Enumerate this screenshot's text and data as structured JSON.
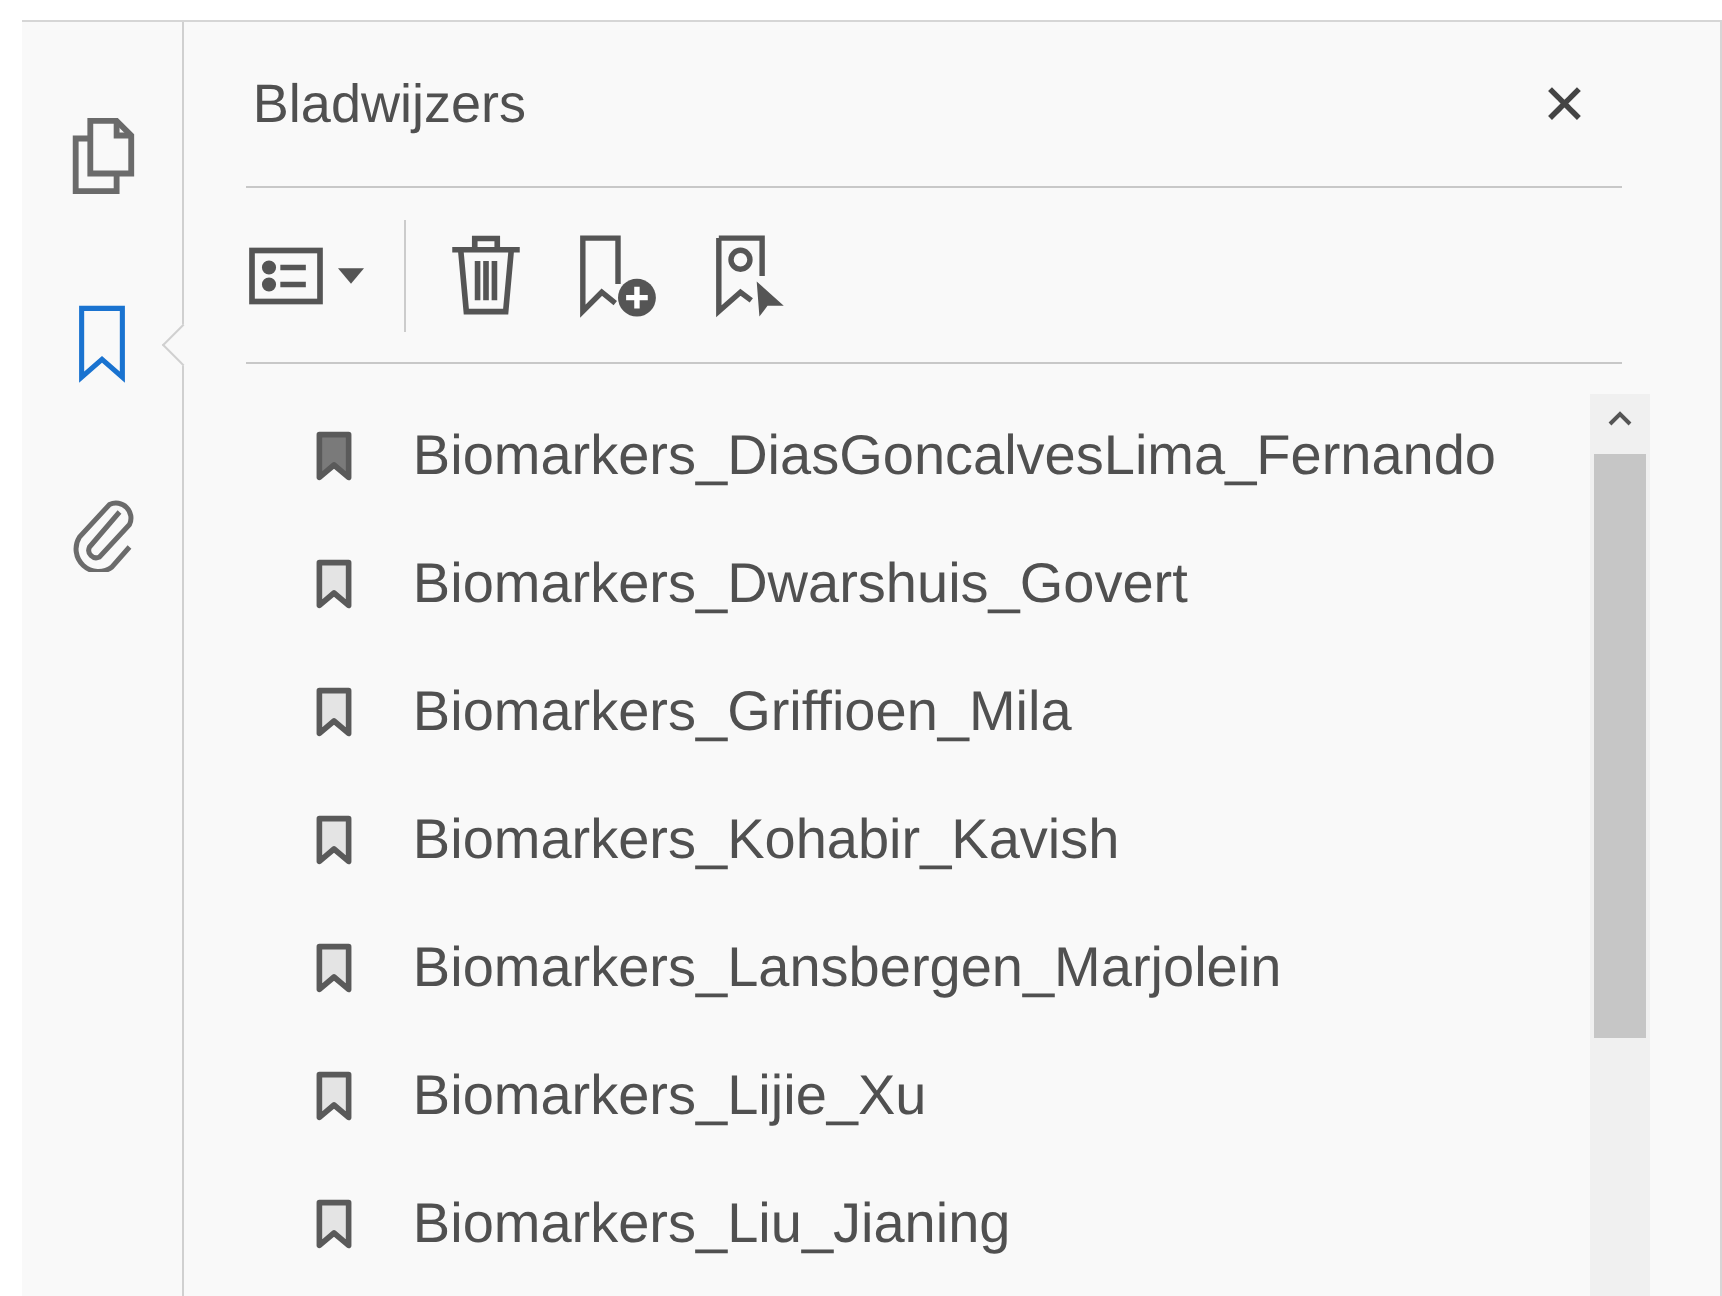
{
  "rail": [
    {
      "kind": "pages",
      "selected": false
    },
    {
      "kind": "bookmarks",
      "selected": true
    },
    {
      "kind": "attachments",
      "selected": false
    }
  ],
  "panel": {
    "title": "Bladwijzers",
    "close": "✕"
  },
  "bookmarks": [
    {
      "label": "Biomarkers_DiasGoncalvesLima_Fernando",
      "selected": true
    },
    {
      "label": "Biomarkers_Dwarshuis_Govert",
      "selected": false
    },
    {
      "label": "Biomarkers_Griffioen_Mila",
      "selected": false
    },
    {
      "label": "Biomarkers_Kohabir_Kavish",
      "selected": false
    },
    {
      "label": "Biomarkers_Lansbergen_Marjolein",
      "selected": false
    },
    {
      "label": "Biomarkers_Lijie_Xu",
      "selected": false
    },
    {
      "label": "Biomarkers_Liu_Jianing",
      "selected": false
    }
  ]
}
